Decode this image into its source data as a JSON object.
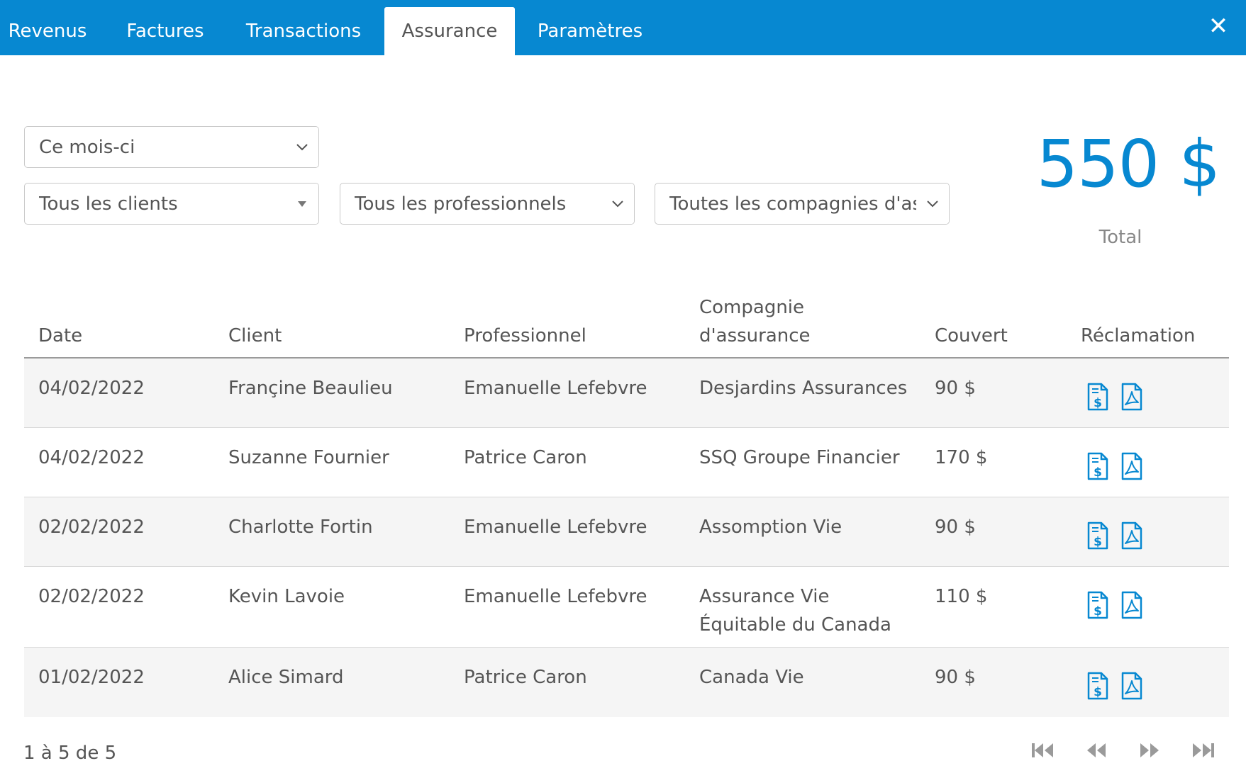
{
  "tabs": [
    {
      "label": "Revenus"
    },
    {
      "label": "Factures"
    },
    {
      "label": "Transactions"
    },
    {
      "label": "Assurance"
    },
    {
      "label": "Paramètres"
    }
  ],
  "close_label": "✕",
  "filters": {
    "period": "Ce mois-ci",
    "clients": "Tous les clients",
    "professionals": "Tous les professionnels",
    "companies": "Toutes les compagnies d'assurance"
  },
  "total": {
    "amount": "550 $",
    "label": "Total"
  },
  "columns": {
    "date": "Date",
    "client": "Client",
    "professional": "Professionnel",
    "company_line1": "Compagnie",
    "company_line2": "d'assurance",
    "covered": "Couvert",
    "claim": "Réclamation"
  },
  "rows": [
    {
      "date": "04/02/2022",
      "client": "Françine Beaulieu",
      "professional": "Emanuelle Lefebvre",
      "company_line1": "Desjardins Assurances",
      "company_line2": "",
      "covered": "90 $"
    },
    {
      "date": "04/02/2022",
      "client": "Suzanne Fournier",
      "professional": "Patrice Caron",
      "company_line1": "SSQ Groupe Financier",
      "company_line2": "",
      "covered": "170 $"
    },
    {
      "date": "02/02/2022",
      "client": "Charlotte Fortin",
      "professional": "Emanuelle Lefebvre",
      "company_line1": "Assomption Vie",
      "company_line2": "",
      "covered": "90 $"
    },
    {
      "date": "02/02/2022",
      "client": "Kevin Lavoie",
      "professional": "Emanuelle Lefebvre",
      "company_line1": "Assurance Vie",
      "company_line2": "Équitable du Canada",
      "covered": "110 $"
    },
    {
      "date": "01/02/2022",
      "client": "Alice Simard",
      "professional": "Patrice Caron",
      "company_line1": "Canada Vie",
      "company_line2": "",
      "covered": "90 $"
    }
  ],
  "pagination": {
    "summary": "1 à 5 de 5"
  },
  "colors": {
    "accent": "#0788d1"
  },
  "icons": {
    "claim_invoice": "invoice-dollar-icon",
    "claim_pdf": "pdf-icon",
    "first": "first-page-icon",
    "prev": "previous-page-icon",
    "next": "next-page-icon",
    "last": "last-page-icon"
  }
}
